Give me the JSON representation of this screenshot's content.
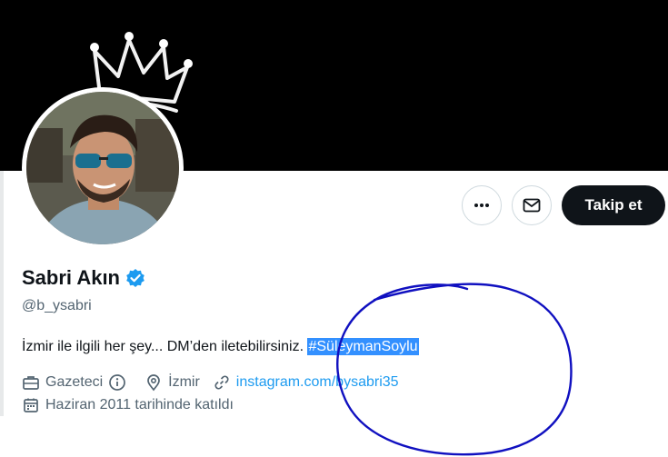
{
  "profile": {
    "name": "Sabri Akın",
    "handle": "@b_ysabri",
    "bio_text": "İzmir ile ilgili her şey... DM’den iletebilirsiniz.",
    "bio_hashtag": "#SüleymanSoylu",
    "profession": "Gazeteci",
    "location": "İzmir",
    "link_text": "instagram.com/bysabri35",
    "joined": "Haziran 2011 tarihinde katıldı"
  },
  "actions": {
    "more_icon": "more-icon",
    "message_icon": "envelope-icon",
    "follow_label": "Takip et"
  },
  "colors": {
    "accent": "#1d9bf0",
    "banner": "#000000",
    "follow_bg": "#0f1419",
    "annotation": "#1010c0"
  }
}
